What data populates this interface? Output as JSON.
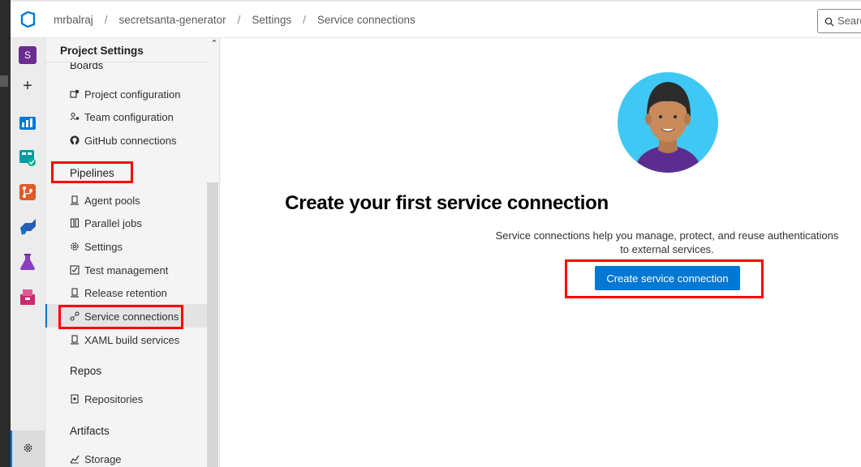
{
  "breadcrumb": {
    "org": "mrbalraj",
    "project": "secretsanta-generator",
    "section": "Settings",
    "page": "Service connections"
  },
  "search": {
    "placeholder": "Search"
  },
  "rail": {
    "project_initial": "S"
  },
  "nav": {
    "header": "Project Settings",
    "boards_section": "Boards",
    "boards_items": [
      {
        "label": "Project configuration",
        "icon": "project-config-icon"
      },
      {
        "label": "Team configuration",
        "icon": "team-config-icon"
      },
      {
        "label": "GitHub connections",
        "icon": "github-icon"
      }
    ],
    "pipelines_section": "Pipelines",
    "pipelines_items": [
      {
        "label": "Agent pools",
        "icon": "agent-pool-icon"
      },
      {
        "label": "Parallel jobs",
        "icon": "parallel-jobs-icon"
      },
      {
        "label": "Settings",
        "icon": "gear-icon"
      },
      {
        "label": "Test management",
        "icon": "test-management-icon"
      },
      {
        "label": "Release retention",
        "icon": "release-retention-icon"
      },
      {
        "label": "Service connections",
        "icon": "service-connection-icon"
      },
      {
        "label": "XAML build services",
        "icon": "xaml-build-icon"
      }
    ],
    "repos_section": "Repos",
    "repos_items": [
      {
        "label": "Repositories",
        "icon": "repository-icon"
      }
    ],
    "artifacts_section": "Artifacts",
    "artifacts_items": [
      {
        "label": "Storage",
        "icon": "storage-icon"
      }
    ]
  },
  "main": {
    "headline": "Create your first service connection",
    "description": "Service connections help you manage, protect, and reuse authentications to external services.",
    "button_label": "Create service connection"
  },
  "colors": {
    "accent": "#0078d4",
    "highlight": "#ff0000",
    "project_badge": "#6b2c91"
  }
}
